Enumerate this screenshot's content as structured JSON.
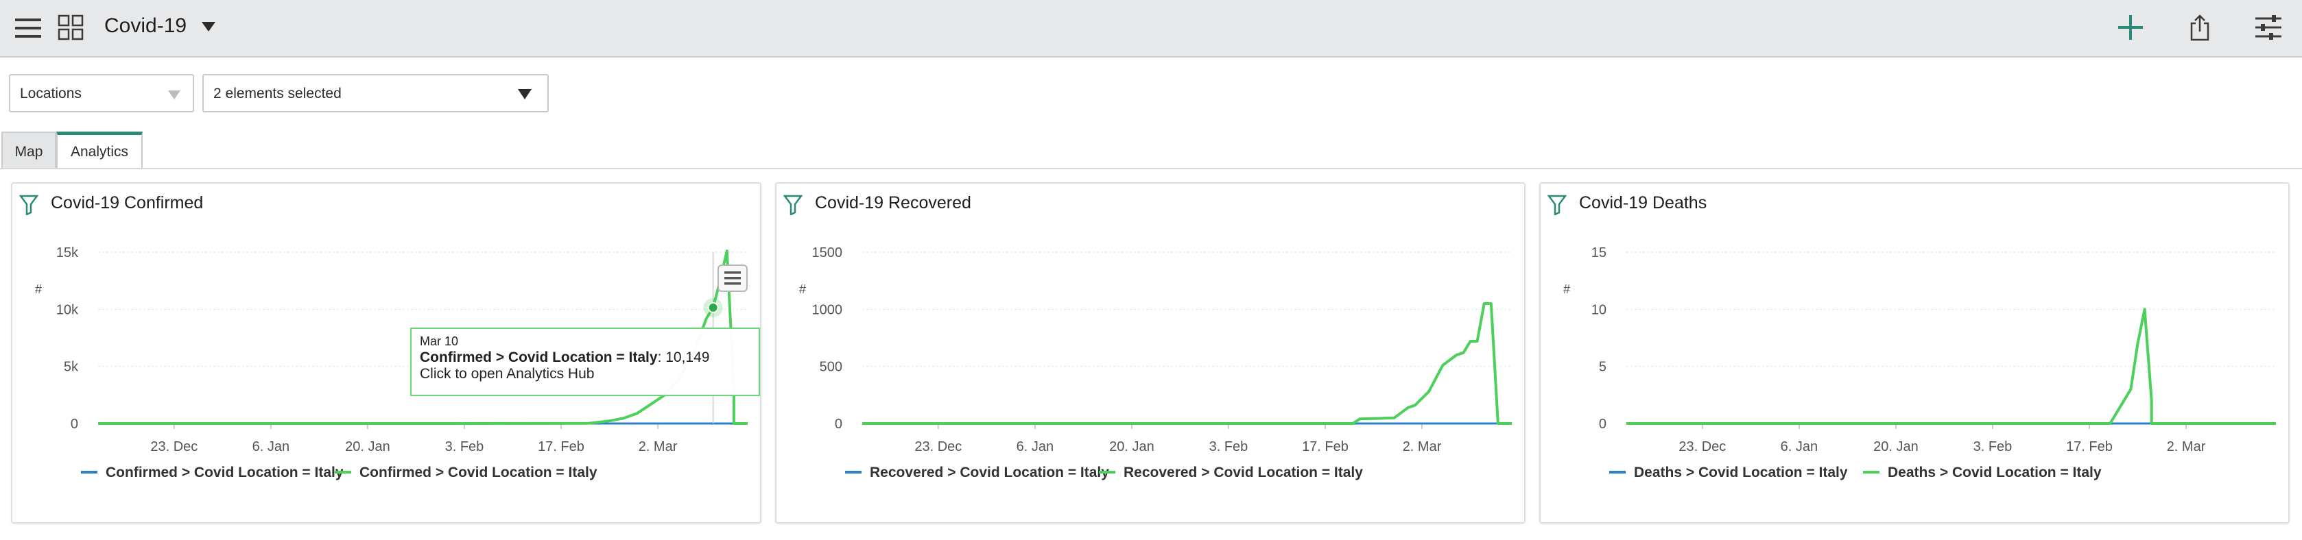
{
  "header": {
    "title": "Covid-19",
    "icons": [
      "hamburger-icon",
      "grid-icon",
      "caret-down-icon",
      "plus-icon",
      "share-icon",
      "settings-sliders-icon"
    ]
  },
  "filters": {
    "locations_label": "Locations",
    "elements_value": "2 elements selected"
  },
  "tabs": [
    {
      "label": "Map",
      "active": false
    },
    {
      "label": "Analytics",
      "active": true
    }
  ],
  "colors": {
    "series_blue": "#2f7fc4",
    "series_green": "#4cd05a",
    "accent": "#2a8a76"
  },
  "panels": [
    {
      "title": "Covid-19 Confirmed",
      "legend": [
        "Confirmed > Covid Location = Italy",
        "Confirmed > Covid Location = Italy"
      ]
    },
    {
      "title": "Covid-19 Recovered",
      "legend": [
        "Recovered > Covid Location = Italy",
        "Recovered > Covid Location = Italy"
      ]
    },
    {
      "title": "Covid-19 Deaths",
      "legend": [
        "Deaths > Covid Location = Italy",
        "Deaths > Covid Location = Italy"
      ]
    }
  ],
  "tooltip": {
    "date": "Mar 10",
    "series": "Confirmed > Covid Location = Italy",
    "value": ": 10,149",
    "hint": "Click to open Analytics Hub"
  },
  "chart_data": [
    {
      "type": "line",
      "title": "Covid-19 Confirmed",
      "ylabel": "#",
      "ylim": [
        0,
        15000
      ],
      "yticks": [
        "0",
        "5k",
        "10k",
        "15k"
      ],
      "xticks": [
        "23. Dec",
        "6. Jan",
        "20. Jan",
        "3. Feb",
        "17. Feb",
        "2. Mar"
      ],
      "x_start": "2019-12-12",
      "x_end": "2020-03-15",
      "series": [
        {
          "name": "Confirmed > Covid Location = Italy",
          "color": "#2f7fc4",
          "points": [
            [
              "2019-12-12",
              0
            ],
            [
              "2020-03-15",
              0
            ]
          ]
        },
        {
          "name": "Confirmed > Covid Location = Italy",
          "color": "#4cd05a",
          "points": [
            [
              "2019-12-12",
              0
            ],
            [
              "2020-01-31",
              0
            ],
            [
              "2020-02-21",
              20
            ],
            [
              "2020-02-24",
              229
            ],
            [
              "2020-02-26",
              453
            ],
            [
              "2020-02-28",
              888
            ],
            [
              "2020-03-01",
              1694
            ],
            [
              "2020-03-03",
              2502
            ],
            [
              "2020-03-05",
              3858
            ],
            [
              "2020-03-07",
              5883
            ],
            [
              "2020-03-09",
              9172
            ],
            [
              "2020-03-10",
              10149
            ],
            [
              "2020-03-11",
              12462
            ],
            [
              "2020-03-12",
              15113
            ],
            [
              "2020-03-13",
              3000
            ],
            [
              "2020-03-13",
              0
            ],
            [
              "2020-03-15",
              0
            ]
          ]
        }
      ],
      "highlight": {
        "date": "2020-03-10",
        "value": 10149
      }
    },
    {
      "type": "line",
      "title": "Covid-19 Recovered",
      "ylabel": "#",
      "ylim": [
        0,
        1500
      ],
      "yticks": [
        "0",
        "500",
        "1000",
        "1500"
      ],
      "xticks": [
        "23. Dec",
        "6. Jan",
        "20. Jan",
        "3. Feb",
        "17. Feb",
        "2. Mar"
      ],
      "x_start": "2019-12-12",
      "x_end": "2020-03-15",
      "series": [
        {
          "name": "Recovered > Covid Location = Italy",
          "color": "#2f7fc4",
          "points": [
            [
              "2019-12-12",
              0
            ],
            [
              "2020-03-15",
              0
            ]
          ]
        },
        {
          "name": "Recovered > Covid Location = Italy",
          "color": "#4cd05a",
          "points": [
            [
              "2019-12-12",
              0
            ],
            [
              "2020-02-21",
              0
            ],
            [
              "2020-02-22",
              40
            ],
            [
              "2020-02-25",
              45
            ],
            [
              "2020-02-27",
              50
            ],
            [
              "2020-02-29",
              140
            ],
            [
              "2020-03-01",
              160
            ],
            [
              "2020-03-03",
              280
            ],
            [
              "2020-03-05",
              510
            ],
            [
              "2020-03-07",
              600
            ],
            [
              "2020-03-08",
              620
            ],
            [
              "2020-03-09",
              720
            ],
            [
              "2020-03-10",
              720
            ],
            [
              "2020-03-11",
              1050
            ],
            [
              "2020-03-12",
              1050
            ],
            [
              "2020-03-13",
              0
            ],
            [
              "2020-03-15",
              0
            ]
          ]
        }
      ]
    },
    {
      "type": "line",
      "title": "Covid-19 Deaths",
      "ylabel": "#",
      "ylim": [
        0,
        15
      ],
      "yticks": [
        "0",
        "5",
        "10",
        "15"
      ],
      "xticks": [
        "23. Dec",
        "6. Jan",
        "20. Jan",
        "3. Feb",
        "17. Feb",
        "2. Mar"
      ],
      "x_start": "2019-12-12",
      "x_end": "2020-03-15",
      "series": [
        {
          "name": "Deaths > Covid Location = Italy",
          "color": "#2f7fc4",
          "points": [
            [
              "2019-12-12",
              0
            ],
            [
              "2020-03-15",
              0
            ]
          ]
        },
        {
          "name": "Deaths > Covid Location = Italy",
          "color": "#4cd05a",
          "points": [
            [
              "2019-12-12",
              0
            ],
            [
              "2020-02-20",
              0
            ],
            [
              "2020-02-22",
              2
            ],
            [
              "2020-02-23",
              3
            ],
            [
              "2020-02-24",
              7
            ],
            [
              "2020-02-25",
              10
            ],
            [
              "2020-02-26",
              2
            ],
            [
              "2020-02-26",
              0
            ],
            [
              "2020-03-15",
              0
            ]
          ]
        }
      ]
    }
  ]
}
